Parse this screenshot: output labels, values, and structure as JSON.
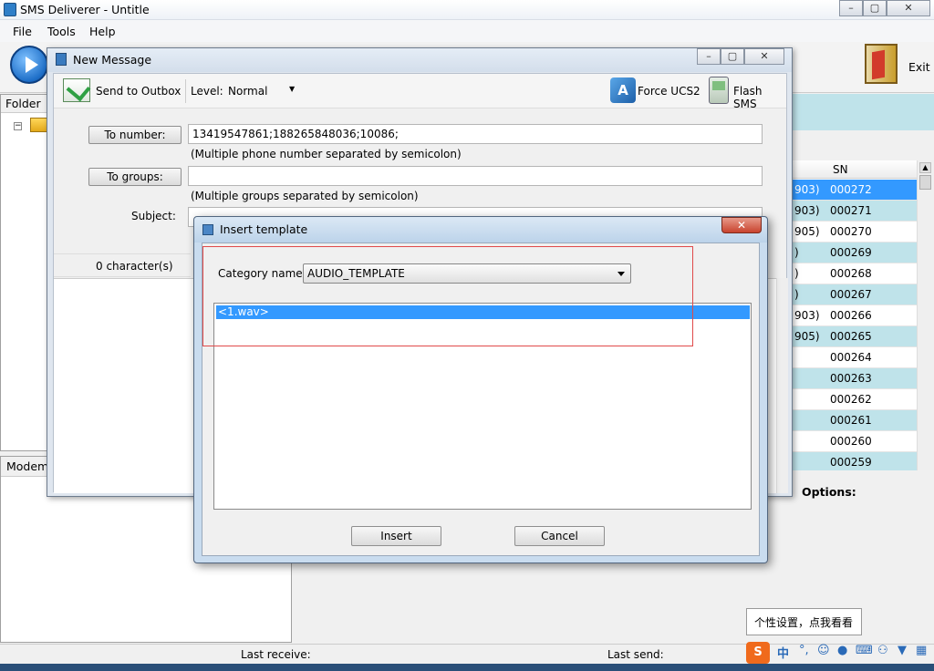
{
  "main_window": {
    "title": "SMS Deliverer - Untitle",
    "menu": [
      "File",
      "Tools",
      "Help"
    ],
    "exit_label": "Exit",
    "folder_label": "Folder",
    "modem_label": "Modem",
    "options_label": "Options:",
    "status": {
      "last_receive": "Last receive:",
      "last_send": "Last send:"
    },
    "grid": {
      "header": "SN",
      "rows": [
        {
          "left": "903)",
          "sn": "000272",
          "style": "selected"
        },
        {
          "left": "903)",
          "sn": "000271",
          "style": "alt"
        },
        {
          "left": "905)",
          "sn": "000270",
          "style": "plain"
        },
        {
          "left": ")",
          "sn": "000269",
          "style": "alt"
        },
        {
          "left": ")",
          "sn": "000268",
          "style": "plain"
        },
        {
          "left": ")",
          "sn": "000267",
          "style": "alt"
        },
        {
          "left": "903)",
          "sn": "000266",
          "style": "plain"
        },
        {
          "left": "905)",
          "sn": "000265",
          "style": "alt"
        },
        {
          "left": "",
          "sn": "000264",
          "style": "plain"
        },
        {
          "left": "",
          "sn": "000263",
          "style": "alt"
        },
        {
          "left": "",
          "sn": "000262",
          "style": "plain"
        },
        {
          "left": "",
          "sn": "000261",
          "style": "alt"
        },
        {
          "left": "",
          "sn": "000260",
          "style": "plain"
        },
        {
          "left": "",
          "sn": "000259",
          "style": "alt"
        }
      ]
    },
    "tooltip": "个性设置，点我看看",
    "ime_zh": "中"
  },
  "new_message": {
    "title": "New Message",
    "toolbar": {
      "send_outbox": "Send to Outbox",
      "level_label": "Level:",
      "level_value": "Normal",
      "force_ucs2": "Force UCS2",
      "flash_sms": "Flash SMS"
    },
    "to_number_btn": "To number:",
    "to_number_value": "13419547861;188265848036;10086;",
    "to_number_hint": "(Multiple phone number separated by semicolon)",
    "to_groups_btn": "To groups:",
    "to_groups_value": "",
    "to_groups_hint": "(Multiple groups separated by semicolon)",
    "subject_label": "Subject:",
    "char_count": "0 character(s)"
  },
  "insert_template": {
    "title": "Insert template",
    "category_label": "Category name",
    "category_value": "AUDIO_TEMPLATE",
    "items": [
      "<1.wav>"
    ],
    "insert_btn": "Insert",
    "cancel_btn": "Cancel"
  },
  "colors": {
    "selection": "#3399ff",
    "row_alt": "#bfe3ea",
    "highlight_box": "#e04a4a"
  }
}
